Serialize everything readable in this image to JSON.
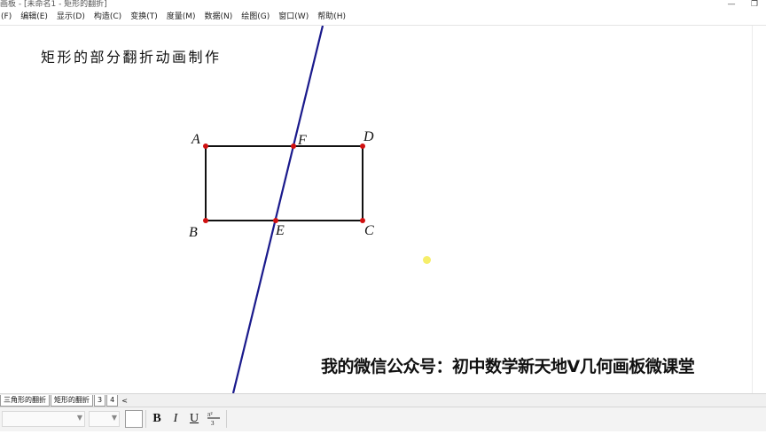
{
  "window": {
    "title": "画板 - [未命名1 - 矩形的翻折]",
    "buttons": [
      "—",
      "❐"
    ]
  },
  "menu": {
    "items": [
      "(F)",
      "编辑(E)",
      "显示(D)",
      "构造(C)",
      "变换(T)",
      "度量(M)",
      "数据(N)",
      "绘图(G)",
      "窗口(W)",
      "帮助(H)"
    ]
  },
  "canvas": {
    "title": "矩形的部分翻折动画制作",
    "points": {
      "A": "A",
      "B": "B",
      "C": "C",
      "D": "D",
      "E": "E",
      "F": "F"
    },
    "watermark": "我的微信公众号：初中数学新天地V几何画板微课堂",
    "colors": {
      "line": "#1a1a8c",
      "points": "#d01010",
      "rectangle": "#111111",
      "cursor": "#f6ee6a"
    }
  },
  "tabs": {
    "items": [
      "三角形的翻折",
      "矩形的翻折",
      "3",
      "4"
    ],
    "active_index": 1,
    "scroll": "<"
  },
  "toolbar": {
    "bold": "B",
    "italic": "I",
    "underline": "U",
    "fraction_icon": "fraction-icon"
  }
}
